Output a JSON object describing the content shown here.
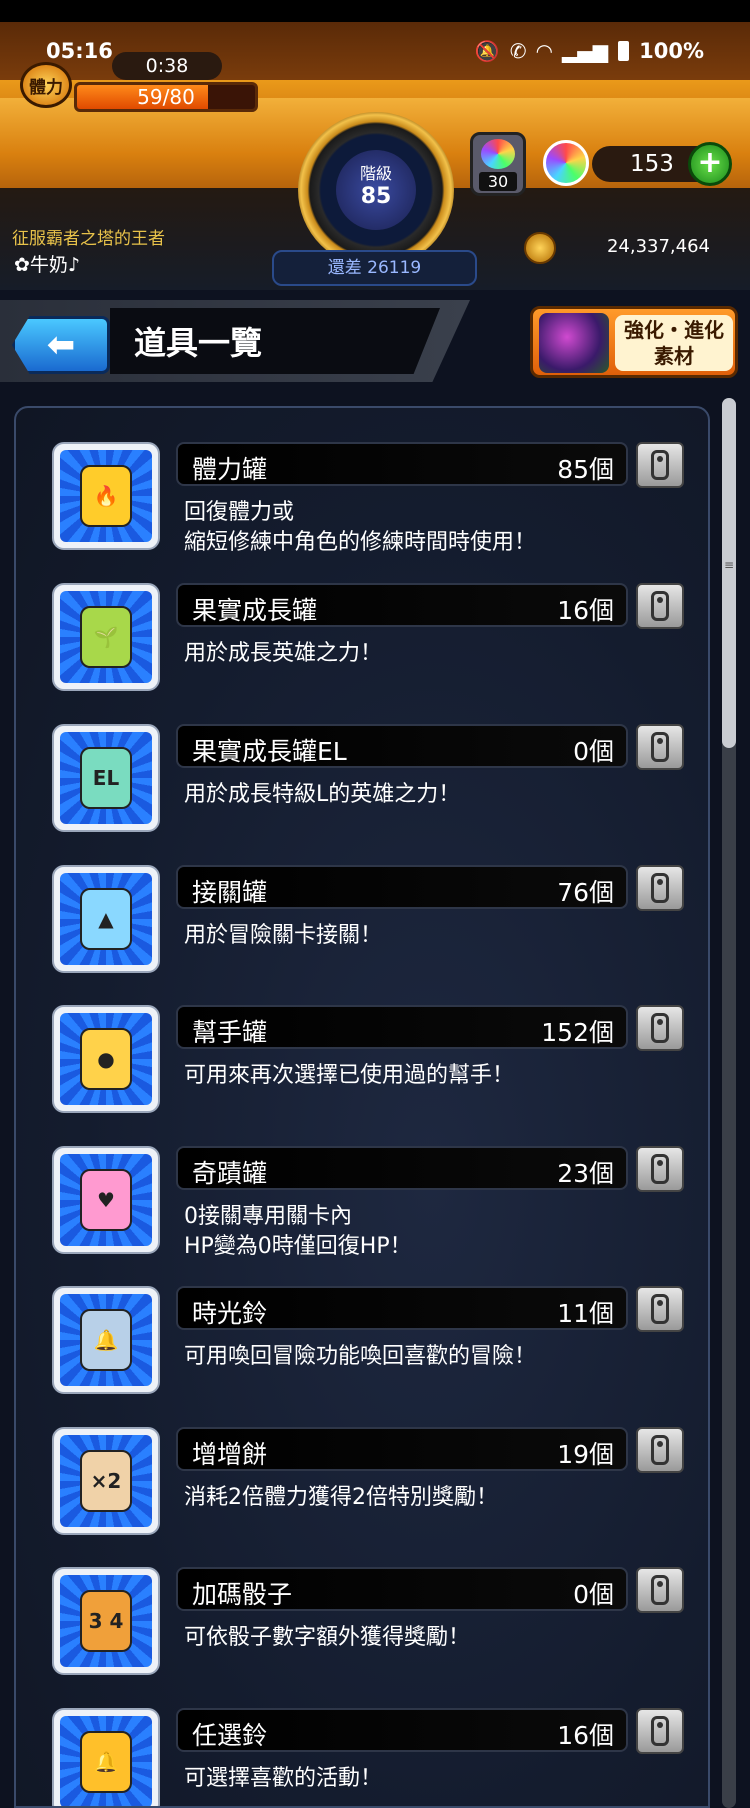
{
  "status_bar": {
    "time": "05:16",
    "battery": "100%"
  },
  "hud": {
    "stamina_label": "體力",
    "stamina_timer": "0:38",
    "stamina_text": "59/80",
    "stamina_fraction": 0.7375,
    "rank_label": "階級",
    "rank_value": "85",
    "rank_diff": "還差 26119",
    "gem_count": "30",
    "orb_count": "153",
    "title": "征服霸者之塔的王者",
    "player_name": "✿牛奶♪",
    "coins": "24,337,464"
  },
  "header": {
    "back_label": "⬅",
    "title": "道具一覽",
    "enhance_label_line1": "強化・進化",
    "enhance_label_line2": "素材"
  },
  "items": [
    {
      "name": "體力罐",
      "count": "85個",
      "desc_lines": [
        "回復體力或",
        "縮短修練中角色的修練時間時使用！"
      ],
      "icon": "stamina-can-icon",
      "glyph_color": "#ffcc2a",
      "glyph": "🔥"
    },
    {
      "name": "果實成長罐",
      "count": "16個",
      "desc_lines": [
        "用於成長英雄之力！"
      ],
      "icon": "fruit-growth-can-icon",
      "glyph_color": "#a8d84a",
      "glyph": "🌱"
    },
    {
      "name": "果實成長罐EL",
      "count": "0個",
      "desc_lines": [
        "用於成長特級L的英雄之力！"
      ],
      "icon": "fruit-growth-can-el-icon",
      "glyph_color": "#7adcc0",
      "glyph": "EL"
    },
    {
      "name": "接關罐",
      "count": "76個",
      "desc_lines": [
        "用於冒險關卡接關！"
      ],
      "icon": "continue-can-icon",
      "glyph_color": "#8ad8ff",
      "glyph": "▲"
    },
    {
      "name": "幫手罐",
      "count": "152個",
      "desc_lines": [
        "可用來再次選擇已使用過的幫手！"
      ],
      "icon": "helper-can-icon",
      "glyph_color": "#ffd24a",
      "glyph": "●"
    },
    {
      "name": "奇蹟罐",
      "count": "23個",
      "desc_lines": [
        "0接關專用關卡內",
        "HP變為0時僅回復HP！"
      ],
      "icon": "miracle-can-icon",
      "glyph_color": "#ff9ad0",
      "glyph": "♥"
    },
    {
      "name": "時光鈴",
      "count": "11個",
      "desc_lines": [
        "可用喚回冒險功能喚回喜歡的冒險！"
      ],
      "icon": "time-bell-icon",
      "glyph_color": "#b8d0e8",
      "glyph": "🔔"
    },
    {
      "name": "增增餅",
      "count": "19個",
      "desc_lines": [
        "消耗2倍體力獲得2倍特別獎勵！"
      ],
      "icon": "boost-cookie-icon",
      "glyph_color": "#f0d2a8",
      "glyph": "×2"
    },
    {
      "name": "加碼骰子",
      "count": "0個",
      "desc_lines": [
        "可依骰子數字額外獲得獎勵！"
      ],
      "icon": "bonus-dice-icon",
      "glyph_color": "#f0a03a",
      "glyph": "3 4"
    },
    {
      "name": "任選鈴",
      "count": "16個",
      "desc_lines": [
        "可選擇喜歡的活動！"
      ],
      "icon": "choice-bell-icon",
      "glyph_color": "#ffc02a",
      "glyph": "🔔"
    }
  ]
}
